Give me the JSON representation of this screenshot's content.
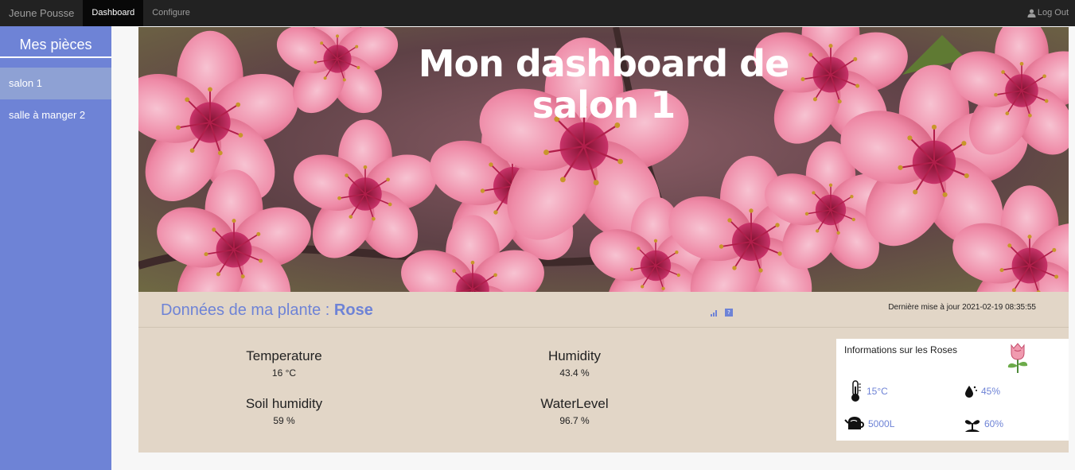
{
  "navbar": {
    "brand": "Jeune Pousse",
    "tabs": [
      {
        "label": "Dashboard",
        "active": true
      },
      {
        "label": "Configure",
        "active": false
      }
    ],
    "logout_label": "Log Out",
    "logout_icon": "user-icon"
  },
  "sidebar": {
    "title": "Mes pièces",
    "items": [
      {
        "label": "salon 1",
        "active": true
      },
      {
        "label": "salle à manger 2",
        "active": false
      }
    ]
  },
  "hero": {
    "title_line1": "Mon dashboard de",
    "title_line2": "salon 1",
    "image": "pink-cherry-blossom-photo"
  },
  "panel": {
    "heading_prefix": "Données de ma plante : ",
    "plant_name": "Rose",
    "last_update": "Dernière mise à jour 2021-02-19 08:35:55",
    "icons": [
      "chart-bars-icon",
      "help-icon"
    ],
    "metrics": [
      {
        "label": "Temperature",
        "value": "16 °C"
      },
      {
        "label": "Humidity",
        "value": "43.4 %"
      },
      {
        "label": "Soil humidity",
        "value": "59 %"
      },
      {
        "label": "WaterLevel",
        "value": "96.7 %"
      }
    ]
  },
  "info": {
    "title": "Informations sur les Roses",
    "icon": "rose-icon",
    "items": [
      {
        "icon": "thermometer-icon",
        "value": "15°C"
      },
      {
        "icon": "water-drop-icon",
        "value": "45%"
      },
      {
        "icon": "watering-can-icon",
        "value": "5000L"
      },
      {
        "icon": "sprout-icon",
        "value": "60%"
      }
    ]
  },
  "colors": {
    "accent": "#6e83d6",
    "navbar": "#222222",
    "panel": "#e2d6c7",
    "sidebar_active": "#8ea1d4"
  }
}
